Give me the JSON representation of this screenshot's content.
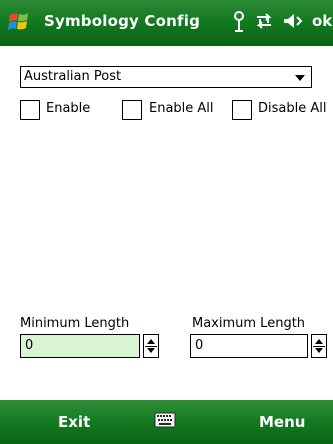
{
  "titlebar": {
    "title": "Symbology Config",
    "ok_label": "ok",
    "icons": [
      "windows-start-icon",
      "antenna-icon",
      "connectivity-icon",
      "speaker-icon"
    ]
  },
  "symbology_select": {
    "selected": "Australian Post"
  },
  "checkboxes": [
    {
      "label": "Enable",
      "checked": false
    },
    {
      "label": "Enable All",
      "checked": false
    },
    {
      "label": "Disable All",
      "checked": false
    }
  ],
  "min_length": {
    "label": "Minimum Length",
    "value": "0"
  },
  "max_length": {
    "label": "Maximum Length",
    "value": "0"
  },
  "softkeys": {
    "left": "Exit",
    "right": "Menu",
    "center_icon": "keyboard-icon"
  },
  "colors": {
    "bar_green": "#137a21",
    "field_focus_green": "#d9f5d4",
    "white": "#ffffff"
  }
}
